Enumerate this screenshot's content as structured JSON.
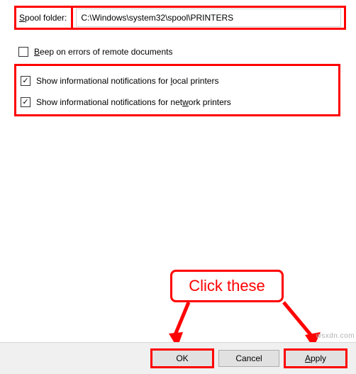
{
  "spool": {
    "label_pre": "",
    "label_u": "S",
    "label_post": "pool folder:",
    "value": "C:\\Windows\\system32\\spool\\PRINTERS"
  },
  "checks": {
    "beep": {
      "checked": false,
      "pre": "",
      "u": "B",
      "post": "eep on errors of remote documents"
    },
    "local": {
      "checked": true,
      "pre": "Show informational notifications for ",
      "u": "l",
      "post": "ocal printers"
    },
    "network": {
      "checked": true,
      "pre": "Show informational notifications for net",
      "u": "w",
      "post": "ork printers"
    }
  },
  "buttons": {
    "ok": "OK",
    "cancel": "Cancel",
    "apply_u": "A",
    "apply_post": "pply"
  },
  "callout": "Click these",
  "watermark": "wsxdn.com",
  "colors": {
    "highlight": "#ff0000"
  }
}
